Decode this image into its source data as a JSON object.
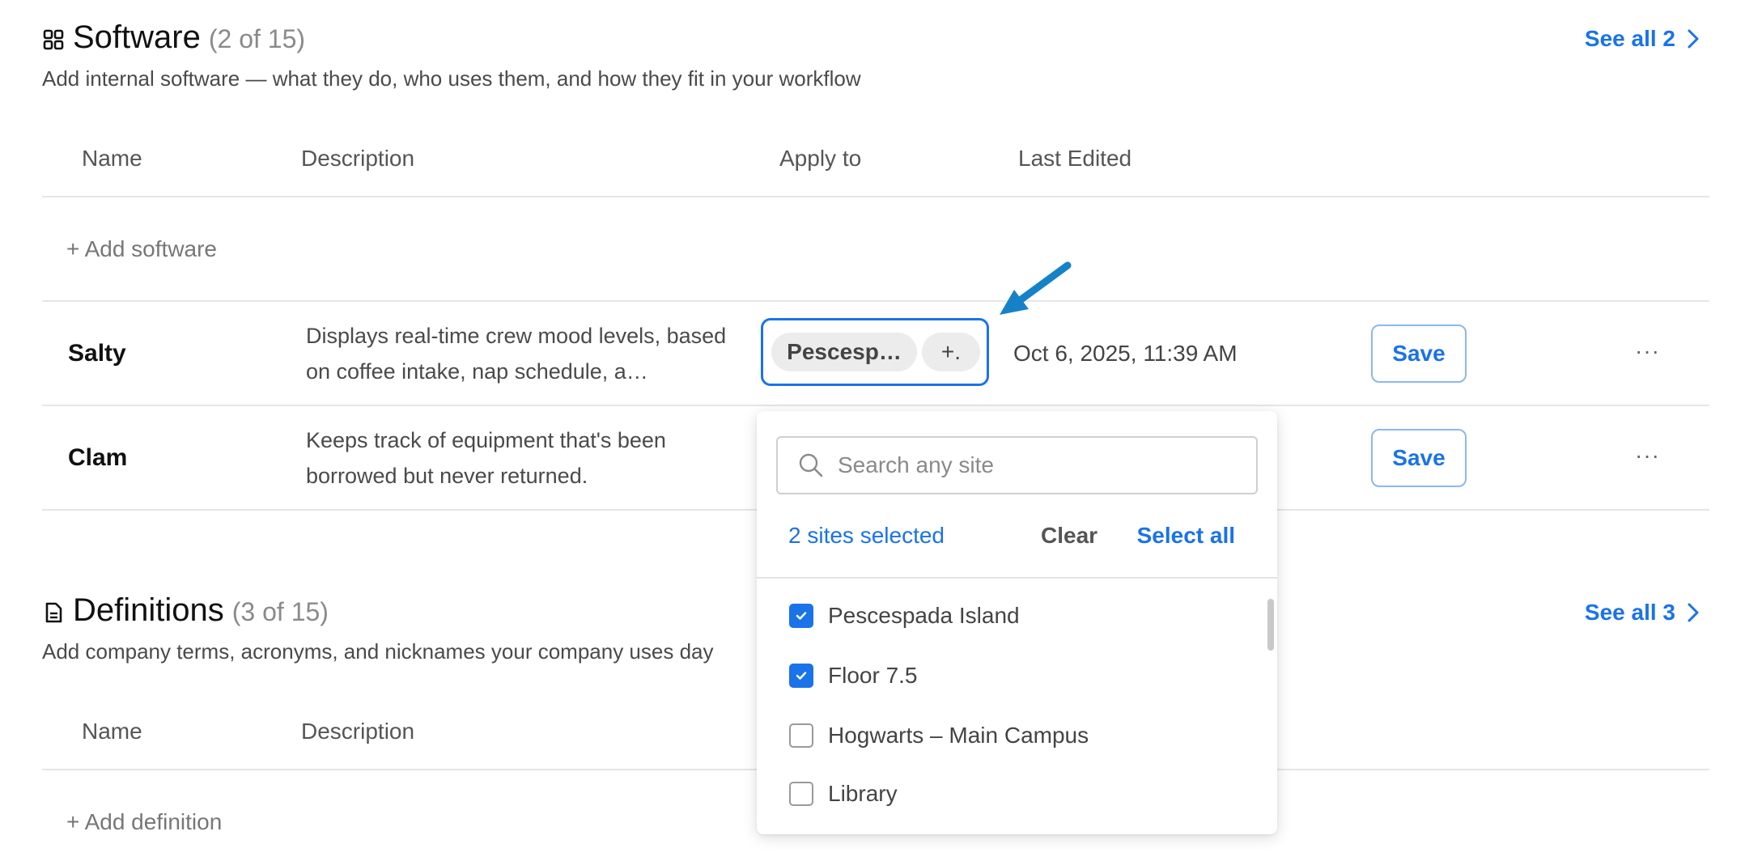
{
  "software": {
    "title": "Software",
    "count": "(2 of 15)",
    "subtitle": "Add internal software — what they do, who uses them, and how they fit in your workflow",
    "see_all": "See all 2",
    "columns": [
      "Name",
      "Description",
      "Apply to",
      "Last Edited"
    ],
    "add_label": "+ Add software",
    "rows": [
      {
        "name": "Salty",
        "description": "Displays real-time crew mood levels, based on coffee intake, nap schedule, a…",
        "apply_chips": [
          "Pescesp…",
          "+."
        ],
        "last_edited": "Oct 6, 2025, 11:39 AM",
        "save_label": "Save",
        "more_label": "···"
      },
      {
        "name": "Clam",
        "description": "Keeps track of equipment that's been borrowed but never returned.",
        "save_label": "Save",
        "more_label": "···"
      }
    ]
  },
  "definitions": {
    "title": "Definitions",
    "count": "(3 of 15)",
    "subtitle": "Add company terms, acronyms, and nicknames your company uses day",
    "see_all": "See all 3",
    "columns": [
      "Name",
      "Description"
    ],
    "add_label": "+ Add definition"
  },
  "site_dropdown": {
    "search_placeholder": "Search any site",
    "selected_count": "2 sites selected",
    "clear_label": "Clear",
    "select_all_label": "Select all",
    "options": [
      {
        "label": "Pescespada Island",
        "checked": true
      },
      {
        "label": "Floor 7.5",
        "checked": true
      },
      {
        "label": "Hogwarts – Main Campus",
        "checked": false
      },
      {
        "label": "Library",
        "checked": false
      }
    ]
  },
  "colors": {
    "accent": "#1a73e8",
    "annotation_arrow": "#1582c8"
  }
}
